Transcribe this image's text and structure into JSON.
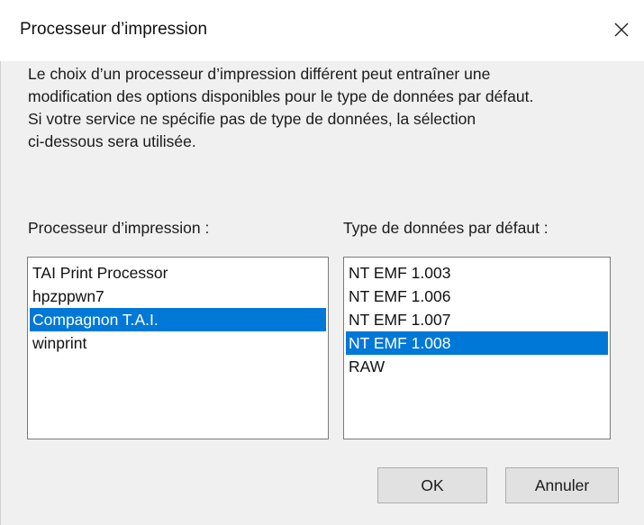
{
  "dialog": {
    "title": "Processeur d’impression",
    "close_icon": "close-icon"
  },
  "description": {
    "lines": [
      "Le choix d’un processeur d’impression différent peut entraîner une",
      "modification des options disponibles pour le type de données par défaut.",
      "Si votre service ne spécifie pas de type de données, la sélection",
      "ci-dessous sera utilisée."
    ]
  },
  "processor_list": {
    "label": "Processeur d’impression :",
    "items": [
      "TAI Print Processor",
      "hpzppwn7",
      "Compagnon T.A.I.",
      "winprint"
    ],
    "selected_index": 2
  },
  "datatype_list": {
    "label": "Type de données par défaut :",
    "items": [
      "NT EMF 1.003",
      "NT EMF 1.006",
      "NT EMF 1.007",
      "NT EMF 1.008",
      "RAW"
    ],
    "selected_index": 3
  },
  "buttons": {
    "ok_label": "OK",
    "cancel_label": "Annuler"
  },
  "colors": {
    "selection": "#0078d7",
    "dialog_background": "#f0f0f0"
  }
}
